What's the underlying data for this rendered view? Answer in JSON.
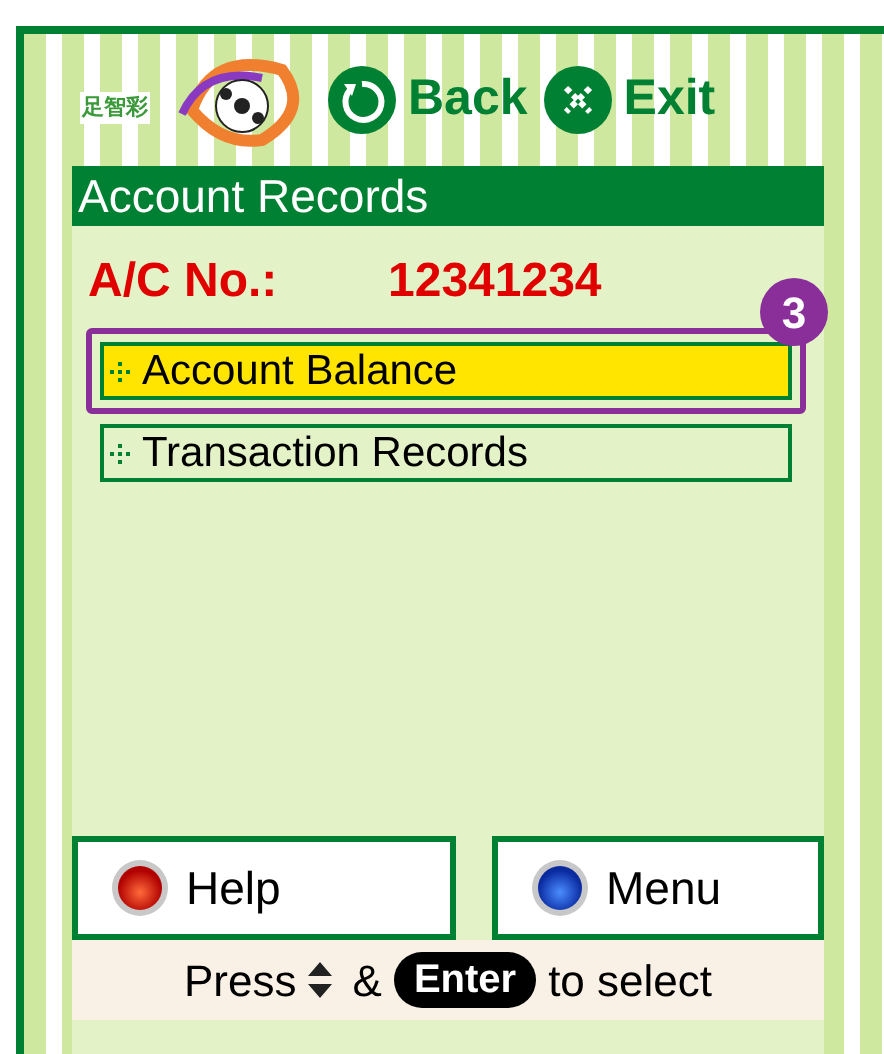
{
  "logo": {
    "text": "足智彩"
  },
  "nav": [
    {
      "kind": "back",
      "label": "Back"
    },
    {
      "kind": "exit",
      "label": "Exit"
    }
  ],
  "title": "Account Records",
  "account": {
    "label": "A/C No.:",
    "number": "12341234"
  },
  "menu": [
    {
      "label": "Account Balance",
      "selected": true,
      "highlighted": true
    },
    {
      "label": "Transaction Records",
      "selected": false,
      "highlighted": false
    }
  ],
  "callout": {
    "number": "3"
  },
  "buttons": [
    {
      "kind": "red",
      "label": "Help"
    },
    {
      "kind": "blue",
      "label": "Menu"
    }
  ],
  "hint": {
    "press": "Press",
    "amp": "&",
    "key": "Enter",
    "rest": "to select"
  }
}
